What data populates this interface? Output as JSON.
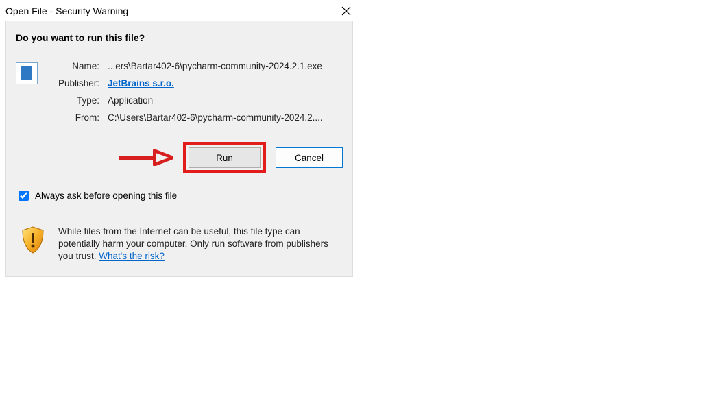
{
  "titlebar": {
    "title": "Open File - Security Warning"
  },
  "heading": "Do you want to run this file?",
  "fields": {
    "name_label": "Name:",
    "name_value": "...ers\\Bartar402-6\\pycharm-community-2024.2.1.exe",
    "publisher_label": "Publisher:",
    "publisher_value": "JetBrains s.r.o.",
    "type_label": "Type:",
    "type_value": "Application",
    "from_label": "From:",
    "from_value": "C:\\Users\\Bartar402-6\\pycharm-community-2024.2...."
  },
  "buttons": {
    "run": "Run",
    "cancel": "Cancel"
  },
  "checkbox": {
    "label": "Always ask before opening this file"
  },
  "warning": {
    "text": "While files from the Internet can be useful, this file type can potentially harm your computer. Only run software from publishers you trust. ",
    "link": "What's the risk?"
  }
}
